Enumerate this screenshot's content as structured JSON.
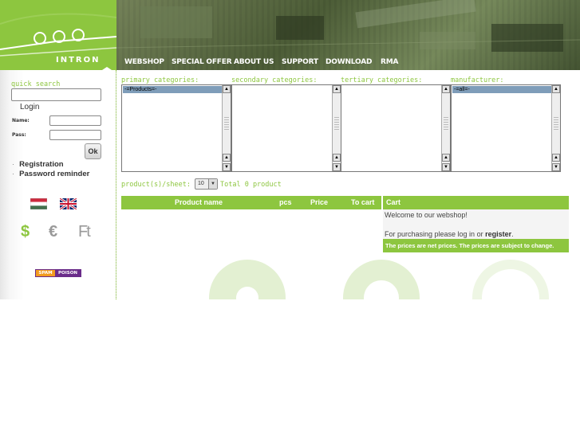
{
  "header": {
    "logo_text": "INTRON",
    "nav": [
      {
        "label": "WEBSHOP"
      },
      {
        "label": "SPECIAL OFFER"
      },
      {
        "label": "ABOUT US"
      },
      {
        "label": "SUPPORT"
      },
      {
        "label": "DOWNLOAD"
      },
      {
        "label": "RMA"
      }
    ]
  },
  "sidebar": {
    "quick_search_label": "quick search",
    "search_value": "",
    "login_label": "Login",
    "name_label": "Name:",
    "pass_label": "Pass:",
    "ok_label": "Ok",
    "links": [
      {
        "label": "Registration"
      },
      {
        "label": "Password reminder"
      }
    ],
    "flags": [
      "hungarian-flag-icon",
      "uk-flag-icon"
    ],
    "currencies": [
      "$",
      "€",
      "Ft"
    ],
    "spam_badge": {
      "left": "SPAM",
      "right": "POISON"
    }
  },
  "filters": {
    "primary_label": "primary categories:",
    "primary_selected": "-=Products=-",
    "secondary_label": "secondary categories:",
    "tertiary_label": "tertiary categories:",
    "manufacturer_label": "manufacturer:",
    "manufacturer_selected": "-=all=-"
  },
  "pagination": {
    "label": "product(s)/sheet:",
    "selected": "10",
    "total": "Total 0 product"
  },
  "table": {
    "columns": [
      "Product name",
      "pcs",
      "Price",
      "To cart"
    ]
  },
  "cart": {
    "title": "Cart",
    "welcome": "Welcome to our webshop!",
    "login_text": "For purchasing please log in or",
    "register_link": "register",
    "login_suffix": ".",
    "note": "The prices are net prices. The prices are subject to change."
  },
  "colors": {
    "accent": "#8dc63f",
    "header_dark": "#3d4a2c",
    "selection": "#7f9db9"
  }
}
